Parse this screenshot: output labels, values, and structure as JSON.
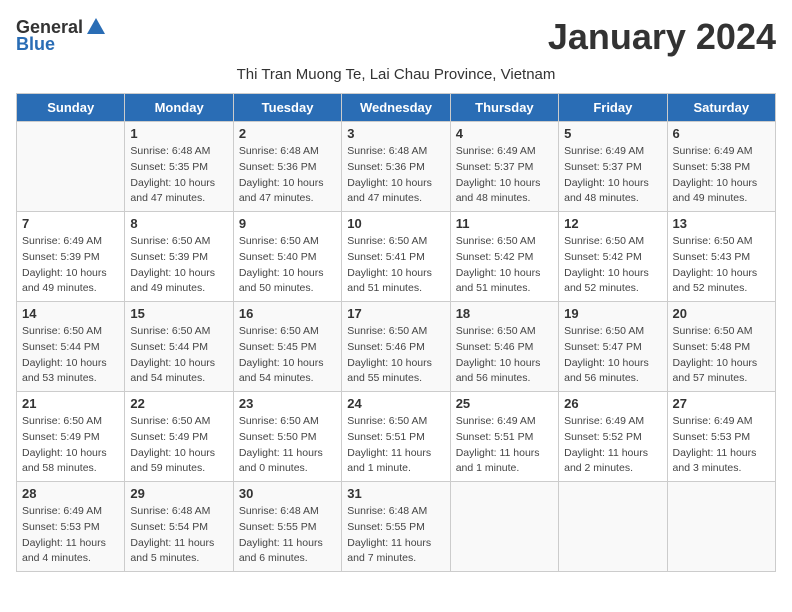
{
  "logo": {
    "general": "General",
    "blue": "Blue"
  },
  "title": "January 2024",
  "subtitle": "Thi Tran Muong Te, Lai Chau Province, Vietnam",
  "days_of_week": [
    "Sunday",
    "Monday",
    "Tuesday",
    "Wednesday",
    "Thursday",
    "Friday",
    "Saturday"
  ],
  "weeks": [
    [
      {
        "day": "",
        "sunrise": "",
        "sunset": "",
        "daylight": ""
      },
      {
        "day": "1",
        "sunrise": "Sunrise: 6:48 AM",
        "sunset": "Sunset: 5:35 PM",
        "daylight": "Daylight: 10 hours and 47 minutes."
      },
      {
        "day": "2",
        "sunrise": "Sunrise: 6:48 AM",
        "sunset": "Sunset: 5:36 PM",
        "daylight": "Daylight: 10 hours and 47 minutes."
      },
      {
        "day": "3",
        "sunrise": "Sunrise: 6:48 AM",
        "sunset": "Sunset: 5:36 PM",
        "daylight": "Daylight: 10 hours and 47 minutes."
      },
      {
        "day": "4",
        "sunrise": "Sunrise: 6:49 AM",
        "sunset": "Sunset: 5:37 PM",
        "daylight": "Daylight: 10 hours and 48 minutes."
      },
      {
        "day": "5",
        "sunrise": "Sunrise: 6:49 AM",
        "sunset": "Sunset: 5:37 PM",
        "daylight": "Daylight: 10 hours and 48 minutes."
      },
      {
        "day": "6",
        "sunrise": "Sunrise: 6:49 AM",
        "sunset": "Sunset: 5:38 PM",
        "daylight": "Daylight: 10 hours and 49 minutes."
      }
    ],
    [
      {
        "day": "7",
        "sunrise": "Sunrise: 6:49 AM",
        "sunset": "Sunset: 5:39 PM",
        "daylight": "Daylight: 10 hours and 49 minutes."
      },
      {
        "day": "8",
        "sunrise": "Sunrise: 6:50 AM",
        "sunset": "Sunset: 5:39 PM",
        "daylight": "Daylight: 10 hours and 49 minutes."
      },
      {
        "day": "9",
        "sunrise": "Sunrise: 6:50 AM",
        "sunset": "Sunset: 5:40 PM",
        "daylight": "Daylight: 10 hours and 50 minutes."
      },
      {
        "day": "10",
        "sunrise": "Sunrise: 6:50 AM",
        "sunset": "Sunset: 5:41 PM",
        "daylight": "Daylight: 10 hours and 51 minutes."
      },
      {
        "day": "11",
        "sunrise": "Sunrise: 6:50 AM",
        "sunset": "Sunset: 5:42 PM",
        "daylight": "Daylight: 10 hours and 51 minutes."
      },
      {
        "day": "12",
        "sunrise": "Sunrise: 6:50 AM",
        "sunset": "Sunset: 5:42 PM",
        "daylight": "Daylight: 10 hours and 52 minutes."
      },
      {
        "day": "13",
        "sunrise": "Sunrise: 6:50 AM",
        "sunset": "Sunset: 5:43 PM",
        "daylight": "Daylight: 10 hours and 52 minutes."
      }
    ],
    [
      {
        "day": "14",
        "sunrise": "Sunrise: 6:50 AM",
        "sunset": "Sunset: 5:44 PM",
        "daylight": "Daylight: 10 hours and 53 minutes."
      },
      {
        "day": "15",
        "sunrise": "Sunrise: 6:50 AM",
        "sunset": "Sunset: 5:44 PM",
        "daylight": "Daylight: 10 hours and 54 minutes."
      },
      {
        "day": "16",
        "sunrise": "Sunrise: 6:50 AM",
        "sunset": "Sunset: 5:45 PM",
        "daylight": "Daylight: 10 hours and 54 minutes."
      },
      {
        "day": "17",
        "sunrise": "Sunrise: 6:50 AM",
        "sunset": "Sunset: 5:46 PM",
        "daylight": "Daylight: 10 hours and 55 minutes."
      },
      {
        "day": "18",
        "sunrise": "Sunrise: 6:50 AM",
        "sunset": "Sunset: 5:46 PM",
        "daylight": "Daylight: 10 hours and 56 minutes."
      },
      {
        "day": "19",
        "sunrise": "Sunrise: 6:50 AM",
        "sunset": "Sunset: 5:47 PM",
        "daylight": "Daylight: 10 hours and 56 minutes."
      },
      {
        "day": "20",
        "sunrise": "Sunrise: 6:50 AM",
        "sunset": "Sunset: 5:48 PM",
        "daylight": "Daylight: 10 hours and 57 minutes."
      }
    ],
    [
      {
        "day": "21",
        "sunrise": "Sunrise: 6:50 AM",
        "sunset": "Sunset: 5:49 PM",
        "daylight": "Daylight: 10 hours and 58 minutes."
      },
      {
        "day": "22",
        "sunrise": "Sunrise: 6:50 AM",
        "sunset": "Sunset: 5:49 PM",
        "daylight": "Daylight: 10 hours and 59 minutes."
      },
      {
        "day": "23",
        "sunrise": "Sunrise: 6:50 AM",
        "sunset": "Sunset: 5:50 PM",
        "daylight": "Daylight: 11 hours and 0 minutes."
      },
      {
        "day": "24",
        "sunrise": "Sunrise: 6:50 AM",
        "sunset": "Sunset: 5:51 PM",
        "daylight": "Daylight: 11 hours and 1 minute."
      },
      {
        "day": "25",
        "sunrise": "Sunrise: 6:49 AM",
        "sunset": "Sunset: 5:51 PM",
        "daylight": "Daylight: 11 hours and 1 minute."
      },
      {
        "day": "26",
        "sunrise": "Sunrise: 6:49 AM",
        "sunset": "Sunset: 5:52 PM",
        "daylight": "Daylight: 11 hours and 2 minutes."
      },
      {
        "day": "27",
        "sunrise": "Sunrise: 6:49 AM",
        "sunset": "Sunset: 5:53 PM",
        "daylight": "Daylight: 11 hours and 3 minutes."
      }
    ],
    [
      {
        "day": "28",
        "sunrise": "Sunrise: 6:49 AM",
        "sunset": "Sunset: 5:53 PM",
        "daylight": "Daylight: 11 hours and 4 minutes."
      },
      {
        "day": "29",
        "sunrise": "Sunrise: 6:48 AM",
        "sunset": "Sunset: 5:54 PM",
        "daylight": "Daylight: 11 hours and 5 minutes."
      },
      {
        "day": "30",
        "sunrise": "Sunrise: 6:48 AM",
        "sunset": "Sunset: 5:55 PM",
        "daylight": "Daylight: 11 hours and 6 minutes."
      },
      {
        "day": "31",
        "sunrise": "Sunrise: 6:48 AM",
        "sunset": "Sunset: 5:55 PM",
        "daylight": "Daylight: 11 hours and 7 minutes."
      },
      {
        "day": "",
        "sunrise": "",
        "sunset": "",
        "daylight": ""
      },
      {
        "day": "",
        "sunrise": "",
        "sunset": "",
        "daylight": ""
      },
      {
        "day": "",
        "sunrise": "",
        "sunset": "",
        "daylight": ""
      }
    ]
  ]
}
